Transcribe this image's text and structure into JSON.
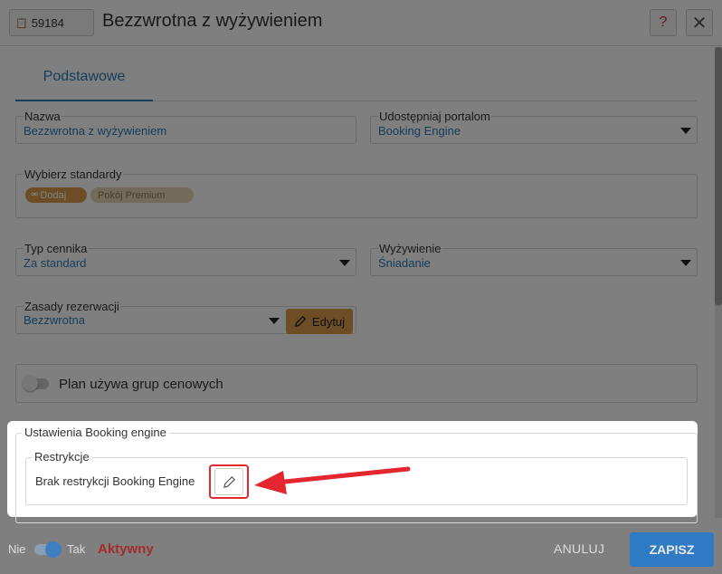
{
  "header": {
    "id_value": "59184",
    "title": "Bezzwrotna z wyżywieniem",
    "help_label": "?",
    "close_label": "✕"
  },
  "tabs": [
    {
      "label": "Podstawowe",
      "active": true
    }
  ],
  "fields": {
    "name": {
      "label": "Nazwa",
      "value": "Bezzwrotna z wyżywieniem"
    },
    "portals": {
      "label": "Udostępniaj portalom",
      "value": "Booking Engine"
    },
    "standards": {
      "label": "Wybierz standardy",
      "add_label": "Dodaj",
      "selected": [
        "Pokój Premium"
      ]
    },
    "pricelist_type": {
      "label": "Typ cennika",
      "value": "Za standard"
    },
    "meal": {
      "label": "Wyżywienie",
      "value": "Śniadanie"
    },
    "booking_rules": {
      "label": "Zasady rezerwacji",
      "value": "Bezzwrotna",
      "edit_label": "Edytuj"
    }
  },
  "price_groups_toggle": {
    "label": "Plan używa grup cenowych",
    "on": false
  },
  "booking_engine": {
    "section_label": "Ustawienia Booking engine",
    "restrictions_label": "Restrykcje",
    "restrictions_text": "Brak restrykcji Booking Engine"
  },
  "footer": {
    "off_label": "Nie",
    "on_label": "Tak",
    "status_label": "Aktywny",
    "cancel_label": "ANULUJ",
    "save_label": "ZAPISZ"
  },
  "colors": {
    "accent": "#2f7bc3",
    "tag_orange": "#d99a4a",
    "status_red": "#a32d2a",
    "highlight_red": "#e3262f"
  }
}
